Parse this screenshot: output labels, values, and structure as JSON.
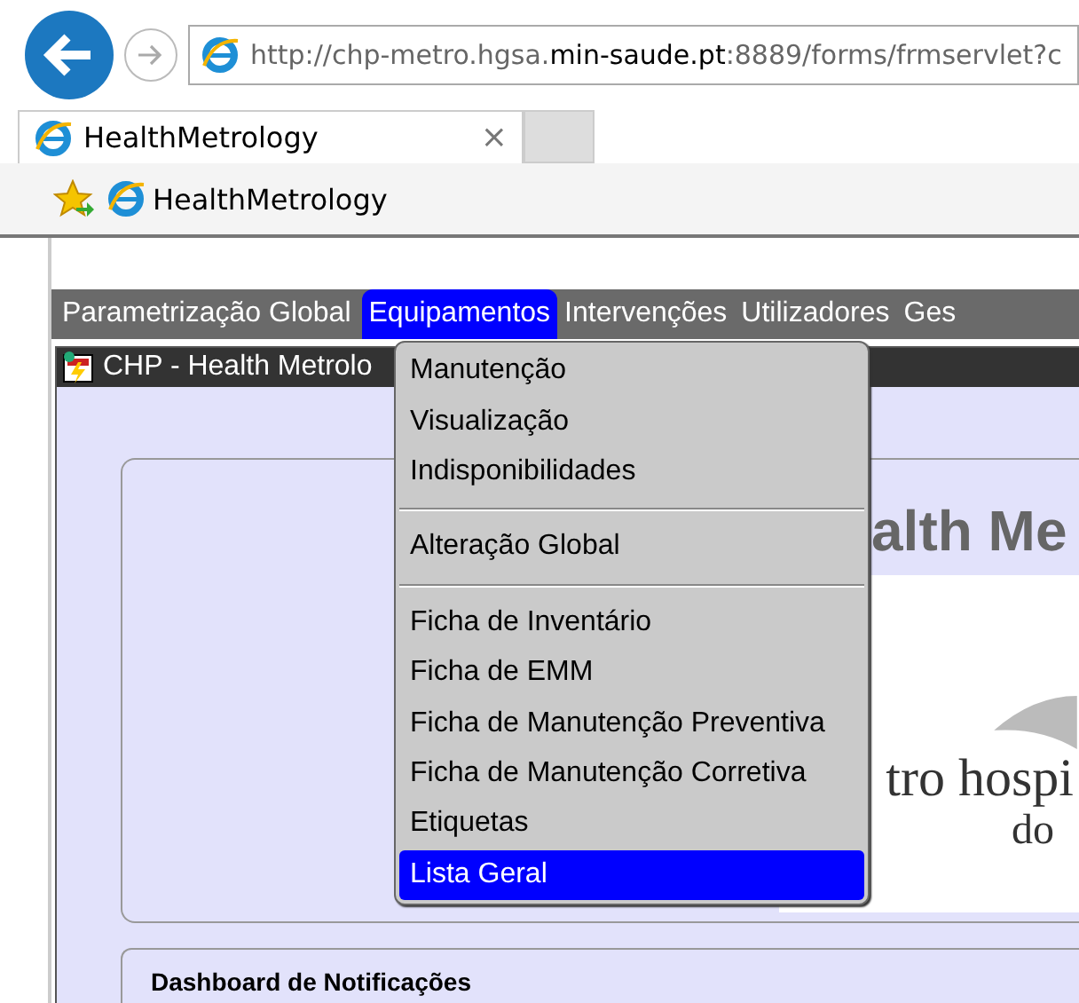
{
  "browser": {
    "url_start": "http://chp-metro.hgsa.",
    "url_domain": "min-saude.pt",
    "url_end": ":8889/forms/frmservlet?c",
    "tabs": [
      {
        "label": "HealthMetrology",
        "selected": true,
        "close": "×"
      }
    ],
    "favorites": [
      {
        "label": "HealthMetrology"
      }
    ]
  },
  "menubar": [
    {
      "label": "Parametrização Global",
      "selected": false
    },
    {
      "label": "Equipamentos",
      "selected": true
    },
    {
      "label": "Intervenções",
      "selected": false
    },
    {
      "label": "Utilizadores",
      "selected": false
    },
    {
      "label": "Ges",
      "selected": false
    }
  ],
  "window": {
    "title": "CHP - Health Metrolo"
  },
  "dropdown": [
    {
      "label": "Manutenção",
      "selected": false,
      "separator_after": false
    },
    {
      "label": "Visualização",
      "selected": false,
      "separator_after": false
    },
    {
      "label": "Indisponibilidades",
      "selected": false,
      "separator_after": true
    },
    {
      "label": "Alteração Global",
      "selected": false,
      "separator_after": true
    },
    {
      "label": "Ficha de Inventário",
      "selected": false,
      "separator_after": false
    },
    {
      "label": "Ficha de EMM",
      "selected": false,
      "separator_after": false
    },
    {
      "label": "Ficha de Manutenção Preventiva",
      "selected": false,
      "separator_after": false
    },
    {
      "label": "Ficha de Manutenção Corretiva",
      "selected": false,
      "separator_after": false
    },
    {
      "label": "Etiquetas",
      "selected": false,
      "separator_after": false
    },
    {
      "label": "Lista Geral",
      "selected": true,
      "separator_after": false
    }
  ],
  "content": {
    "heading": "alth Me",
    "logo_lines": [
      "tro hospi",
      "do"
    ],
    "dashboard_title": "Dashboard de Notificações"
  }
}
